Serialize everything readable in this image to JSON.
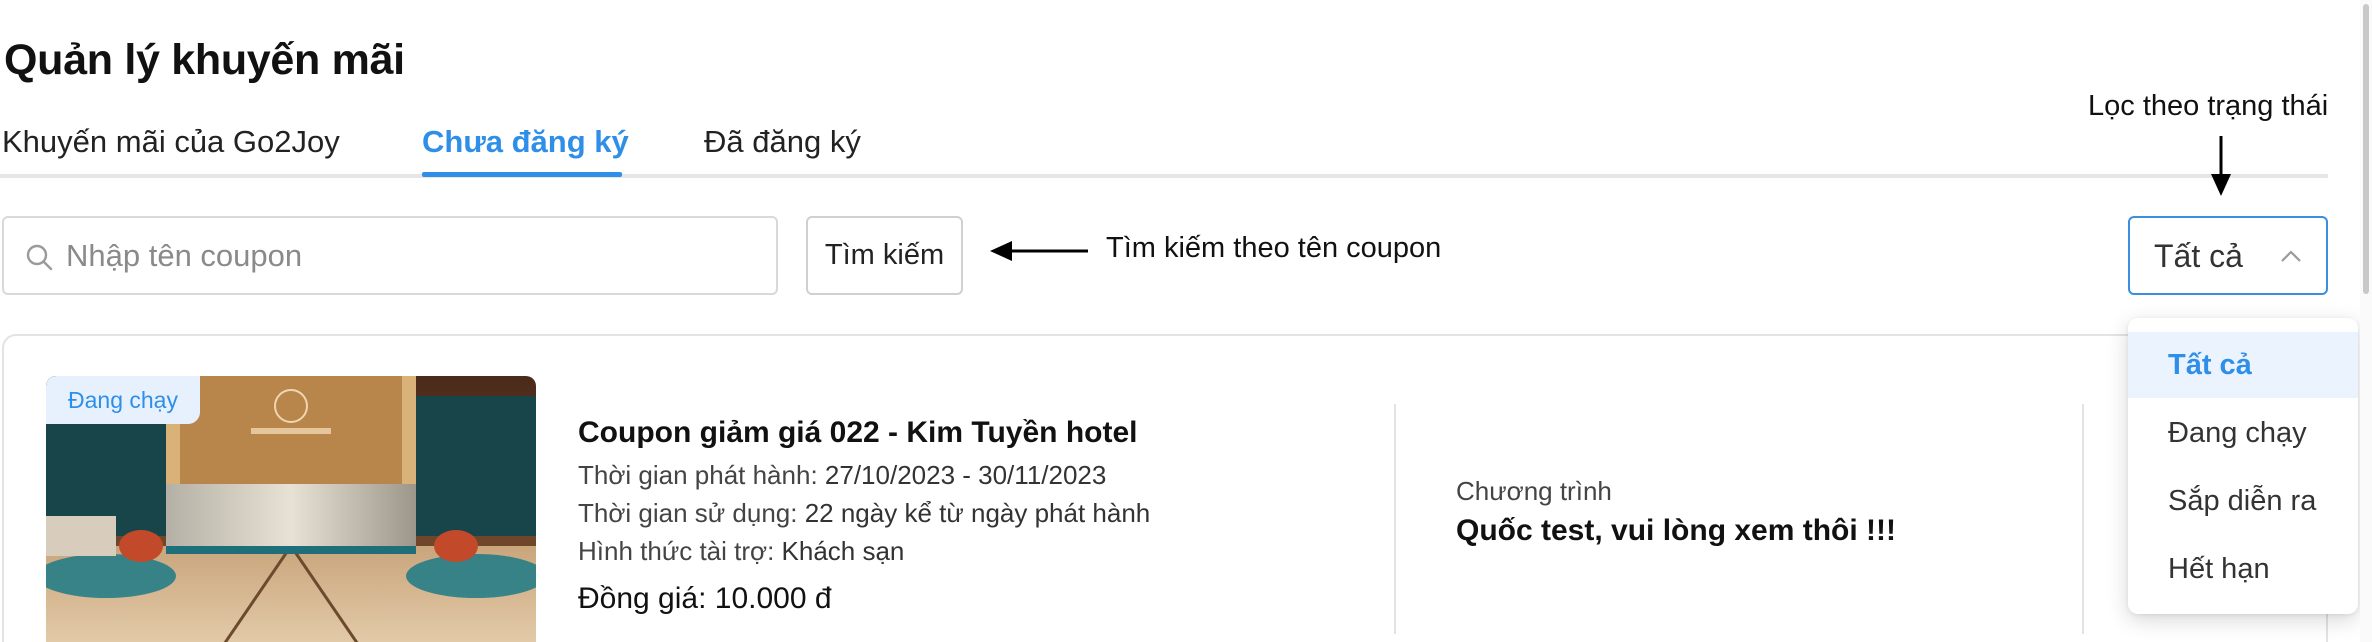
{
  "page": {
    "title": "Quản lý khuyến mãi"
  },
  "tabs": [
    {
      "label": "Khuyến mãi của Go2Joy",
      "active": false
    },
    {
      "label": "Chưa đăng ký",
      "active": true
    },
    {
      "label": "Đã đăng ký",
      "active": false
    }
  ],
  "search": {
    "placeholder": "Nhập tên coupon",
    "value": "",
    "button_label": "Tìm kiếm",
    "icon": "search-icon"
  },
  "annotations": {
    "search_hint": "Tìm kiếm theo tên coupon",
    "filter_hint": "Lọc theo trạng thái"
  },
  "status_filter": {
    "selected": "Tất cả",
    "expanded": true,
    "options": [
      "Tất cả",
      "Đang chạy",
      "Sắp diễn ra",
      "Hết hạn"
    ]
  },
  "coupon": {
    "status_badge": "Đang chạy",
    "title": "Coupon giảm giá 022 - Kim Tuyền hotel",
    "issue_label": "Thời gian phát hành:",
    "issue_period": "27/10/2023 - 30/11/2023",
    "usage_label": "Thời gian sử dụng:",
    "usage_period": "22 ngày kể từ ngày phát hành",
    "sponsor_label": "Hình thức tài trợ:",
    "sponsor_value": "Khách sạn",
    "price_label": "Đồng giá:",
    "price_value": "10.000 đ",
    "program_label": "Chương trình",
    "program_name": "Quốc test, vui lòng xem thôi !!!"
  },
  "colors": {
    "accent": "#2f8fe8",
    "badge_bg": "#e7f1fd",
    "border": "#d9d9d9"
  }
}
